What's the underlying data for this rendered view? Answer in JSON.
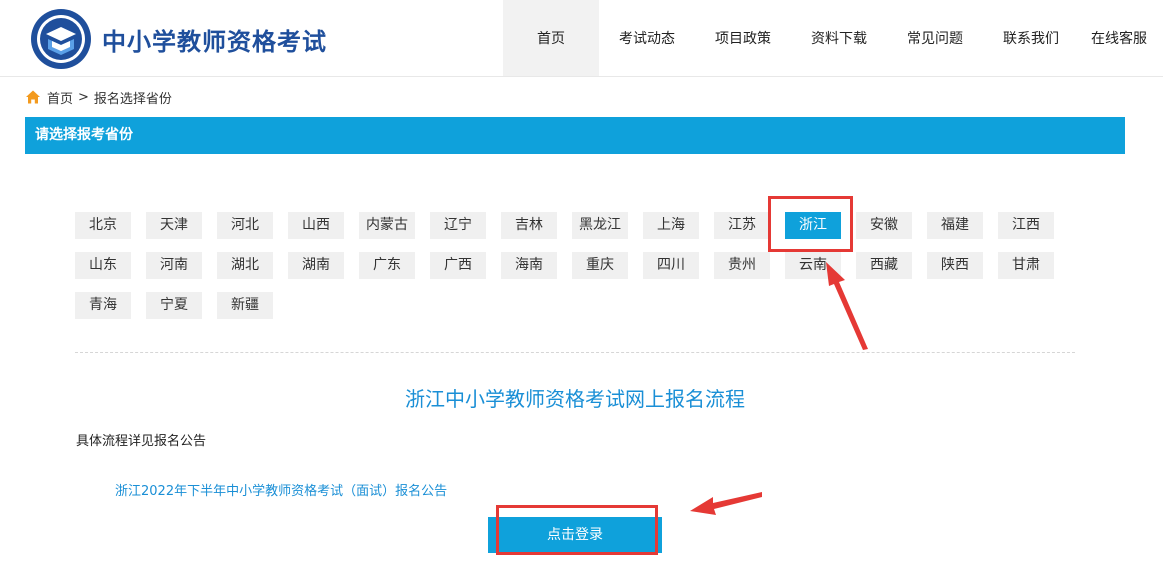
{
  "site": {
    "title": "中小学教师资格考试"
  },
  "nav": {
    "items": [
      {
        "label": "首页",
        "active": true
      },
      {
        "label": "考试动态"
      },
      {
        "label": "项目政策"
      },
      {
        "label": "资料下载"
      },
      {
        "label": "常见问题"
      },
      {
        "label": "联系我们"
      },
      {
        "label": "在线客服"
      }
    ]
  },
  "breadcrumb": {
    "home": "首页",
    "separator": ">",
    "current": "报名选择省份"
  },
  "section": {
    "title": "请选择报考省份"
  },
  "provinces": {
    "items": [
      "北京",
      "天津",
      "河北",
      "山西",
      "内蒙古",
      "辽宁",
      "吉林",
      "黑龙江",
      "上海",
      "江苏",
      "浙江",
      "安徽",
      "福建",
      "江西",
      "山东",
      "河南",
      "湖北",
      "湖南",
      "广东",
      "广西",
      "海南",
      "重庆",
      "四川",
      "贵州",
      "云南",
      "西藏",
      "陕西",
      "甘肃",
      "青海",
      "宁夏",
      "新疆"
    ],
    "selected": "浙江"
  },
  "flow": {
    "title": "浙江中小学教师资格考试网上报名流程",
    "desc": "具体流程详见报名公告",
    "notice_link": "浙江2022年下半年中小学教师资格考试（面试）报名公告"
  },
  "login": {
    "label": "点击登录"
  },
  "colors": {
    "brand_blue": "#0fa1db",
    "title_blue": "#1f4f9c",
    "link_blue": "#1a8fd6",
    "annotation_red": "#e53935"
  },
  "icons": {
    "home": "home-icon",
    "logo": "seal-logo"
  }
}
